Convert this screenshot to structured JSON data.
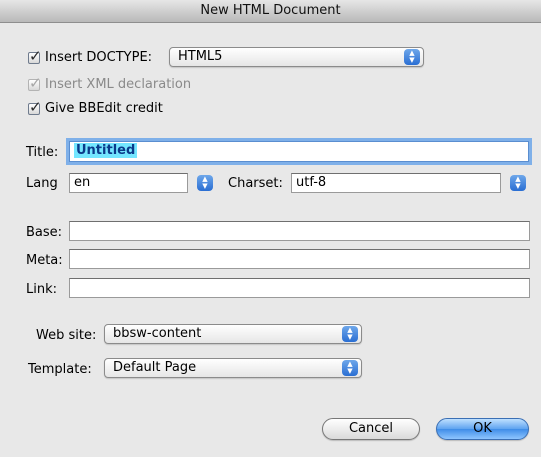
{
  "window": {
    "title": "New HTML Document"
  },
  "options": {
    "insert_doctype": {
      "label": "Insert DOCTYPE:",
      "checked": true,
      "value": "HTML5"
    },
    "insert_xml": {
      "label": "Insert XML declaration",
      "checked": true,
      "enabled": false
    },
    "give_credit": {
      "label": "Give BBEdit credit",
      "checked": true
    }
  },
  "form": {
    "title_label": "Title:",
    "title_value": "Untitled",
    "lang_label": "Lang",
    "lang_value": "en",
    "charset_label": "Charset:",
    "charset_value": "utf-8",
    "base_label": "Base:",
    "meta_label": "Meta:",
    "link_label": "Link:",
    "website_label": "Web site:",
    "website_value": "bbsw-content",
    "template_label": "Template:",
    "template_value": "Default Page"
  },
  "buttons": {
    "cancel": "Cancel",
    "ok": "OK"
  },
  "icons": {
    "checkmark": "checkmark-icon",
    "stepper": "popup-stepper-icon"
  },
  "colors": {
    "selection": "#74e6ff",
    "default_button": "#3f8de8",
    "focus_ring": "#7fb0e9"
  }
}
